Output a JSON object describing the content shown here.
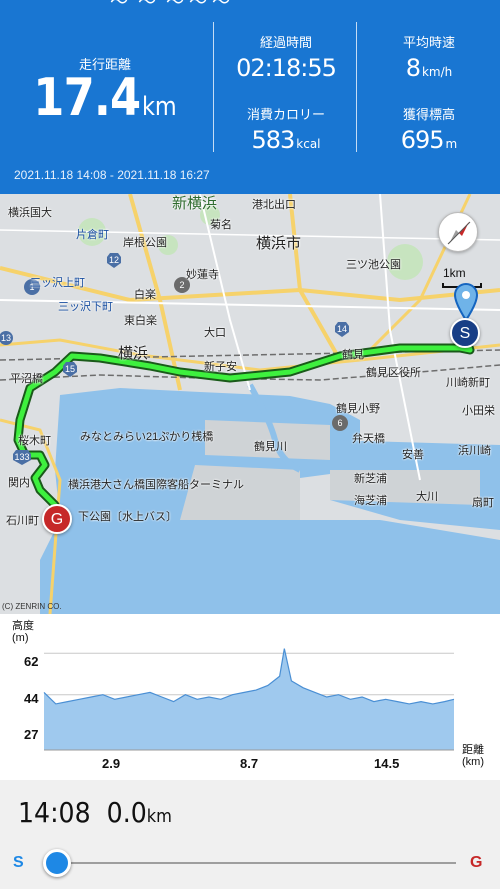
{
  "stats": {
    "distance": {
      "label": "走行距離",
      "value": "17.4",
      "unit": "km"
    },
    "elapsed": {
      "label": "経過時間",
      "value": "02:18:55"
    },
    "avg_speed": {
      "label": "平均時速",
      "value": "8",
      "unit": "km/h"
    },
    "calories": {
      "label": "消費カロリー",
      "value": "583",
      "unit": "kcal"
    },
    "elevation_gain": {
      "label": "獲得標高",
      "value": "695",
      "unit": "m"
    },
    "date_range": "2021.11.18 14:08 - 2021.11.18 16:27"
  },
  "map": {
    "labels": {
      "shin_yokohama": "新横浜",
      "yokohama_shi": "横浜市",
      "kikuna": "菊名",
      "kurata": "片倉町",
      "kishine": "岸根公園",
      "myorenji": "妙蓮寺",
      "hakuraku": "白楽",
      "higashi_hakuraku": "東白楽",
      "mitsuzawa_kami": "三ッ沢上町",
      "mitsuzawa_shimo": "三ッ沢下町",
      "oguchi": "大口",
      "shinkoyasu": "新子安",
      "tsurumi": "鶴見",
      "tsurumi_ku": "鶴見区役所",
      "tsurumi_ono": "鶴見小野",
      "tsurumi_gawa": "鶴見川",
      "benten": "弁天橋",
      "anzen": "安善",
      "shinshiba": "新芝浦",
      "umishibaura": "海芝浦",
      "okawa": "大川",
      "hamakawasaki": "浜川崎",
      "ogimachi": "扇町",
      "kawasaki_shinmachi": "川崎新町",
      "odasakae": "小田栄",
      "minatomirai": "みなとみらい21ぷかり桟橋",
      "osanbashi": "横浜港大さん橋国際客船ターミナル",
      "yamashita": "下公園〔水上バス〕",
      "sakuragicho": "桜木町",
      "kannai": "関内",
      "ishikawa": "石川町",
      "hiranuma": "平沼橋",
      "kohoku": "港北出口",
      "yokohama_daigaku": "横浜国大",
      "mitsuike": "三ツ池公園",
      "yokohama_st": "横浜"
    },
    "route_numbers": [
      "1",
      "2",
      "6",
      "12",
      "13",
      "14",
      "15",
      "133"
    ],
    "scale_label": "1km",
    "start_marker": "S",
    "goal_marker": "G",
    "copyright": "(C) ZENRIN CO."
  },
  "elevation": {
    "title_line1": "高度",
    "title_line2": "(m)",
    "y_ticks": [
      "62",
      "44",
      "27"
    ],
    "x_ticks": [
      "2.9",
      "8.7",
      "14.5"
    ],
    "x_title_line1": "距離",
    "x_title_line2": "(km)"
  },
  "chart_data": {
    "type": "area",
    "xlabel": "距離 (km)",
    "ylabel": "高度 (m)",
    "xlim": [
      0,
      17.4
    ],
    "ylim": [
      20,
      66
    ],
    "x": [
      0,
      0.5,
      1.0,
      1.5,
      2.0,
      2.5,
      3.0,
      3.5,
      4.0,
      4.5,
      5.0,
      5.5,
      6.0,
      6.5,
      7.0,
      7.5,
      8.0,
      8.5,
      9.0,
      9.5,
      10.0,
      10.2,
      10.5,
      11.0,
      11.5,
      12.0,
      12.5,
      13.0,
      13.5,
      14.0,
      14.5,
      15.0,
      15.5,
      16.0,
      16.5,
      17.0,
      17.4
    ],
    "values": [
      45,
      40,
      41,
      42,
      43,
      44,
      42,
      43,
      44,
      45,
      43,
      41,
      44,
      42,
      43,
      42,
      44,
      45,
      46,
      48,
      52,
      64,
      50,
      47,
      45,
      43,
      44,
      42,
      43,
      41,
      42,
      41,
      40,
      41,
      40,
      41,
      42
    ]
  },
  "player": {
    "time": "14:08",
    "distance": "0.0",
    "unit": "km",
    "start_label": "S",
    "goal_label": "G",
    "progress": 0.0
  }
}
